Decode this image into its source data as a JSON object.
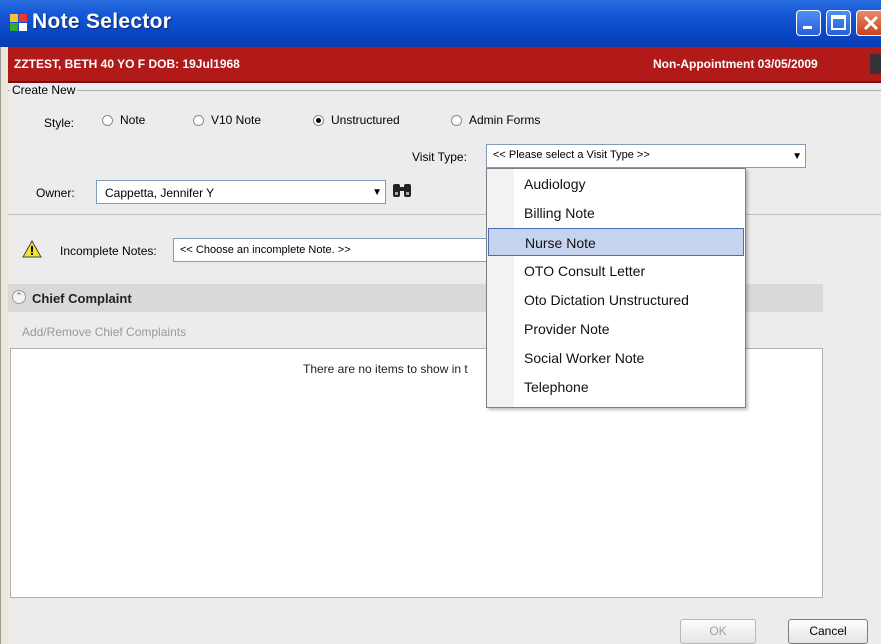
{
  "window": {
    "title": "Note Selector"
  },
  "banner": {
    "patient": "ZZTEST, BETH  40 YO  F DOB: 19Jul1968",
    "appointment": "Non-Appointment  03/05/2009"
  },
  "create_new": {
    "legend": "Create New",
    "style_label": "Style:",
    "styles": [
      {
        "label": "Note",
        "selected": false
      },
      {
        "label": "V10 Note",
        "selected": false
      },
      {
        "label": "Unstructured",
        "selected": true
      },
      {
        "label": "Admin Forms",
        "selected": false
      }
    ],
    "visit_type_label": "Visit Type:",
    "visit_type_value": "<< Please select a Visit Type >>",
    "owner_label": "Owner:",
    "owner_value": "Cappetta, Jennifer Y"
  },
  "incomplete": {
    "label": "Incomplete Notes:",
    "value": "<< Choose an incomplete Note. >>"
  },
  "chief_complaint": {
    "title": "Chief Complaint",
    "add_link": "Add/Remove Chief Complaints",
    "empty_text": "There are no items to show in t"
  },
  "visit_type_options": [
    {
      "label": "Audiology",
      "selected": false
    },
    {
      "label": "Billing Note",
      "selected": false
    },
    {
      "label": "Nurse Note",
      "selected": true
    },
    {
      "label": "OTO Consult Letter",
      "selected": false
    },
    {
      "label": "Oto Dictation Unstructured",
      "selected": false
    },
    {
      "label": "Provider Note",
      "selected": false
    },
    {
      "label": "Social Worker Note",
      "selected": false
    },
    {
      "label": "Telephone",
      "selected": false
    }
  ],
  "buttons": {
    "ok": "OK",
    "cancel": "Cancel"
  },
  "colors": {
    "title_bar": "#0a46c4",
    "banner": "#b21a1a",
    "selection": "#c5d3ee"
  }
}
